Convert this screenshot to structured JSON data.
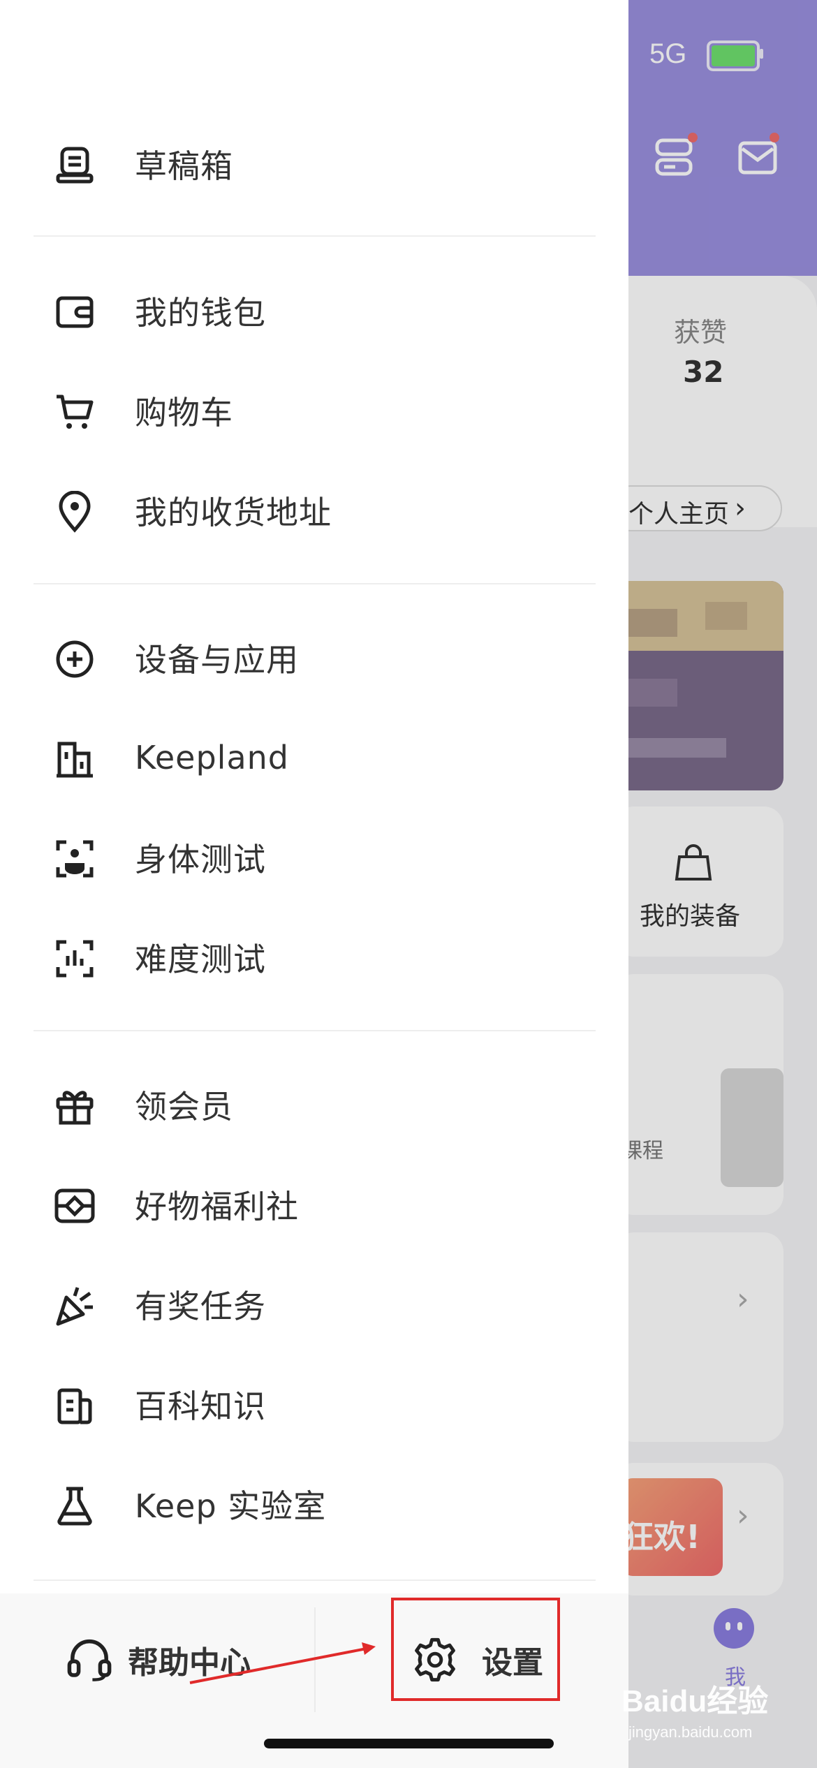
{
  "status_bar": {
    "network": "5G"
  },
  "background": {
    "likes_label": "获赞",
    "likes_count": "32",
    "profile_link": "个人主页",
    "equipment_label": "我的装备",
    "course_text": "课程",
    "banner_text": "狂欢!",
    "tab_me_label": "我",
    "colors": {
      "header": "#9a90df",
      "accent": "#8a7ee0"
    }
  },
  "drawer": {
    "groups": [
      {
        "items": [
          {
            "label": "草稿箱",
            "icon": "drafts-icon"
          }
        ]
      },
      {
        "items": [
          {
            "label": "我的钱包",
            "icon": "wallet-icon"
          },
          {
            "label": "购物车",
            "icon": "cart-icon"
          },
          {
            "label": "我的收货地址",
            "icon": "location-pin-icon"
          }
        ]
      },
      {
        "items": [
          {
            "label": "设备与应用",
            "icon": "plus-circle-icon"
          },
          {
            "label": "Keepland",
            "icon": "building-icon"
          },
          {
            "label": "身体测试",
            "icon": "body-scan-icon"
          },
          {
            "label": "难度测试",
            "icon": "difficulty-scan-icon"
          }
        ]
      },
      {
        "items": [
          {
            "label": "领会员",
            "icon": "gift-icon"
          },
          {
            "label": "好物福利社",
            "icon": "goods-icon"
          },
          {
            "label": "有奖任务",
            "icon": "party-popper-icon"
          },
          {
            "label": "百科知识",
            "icon": "encyclopedia-icon"
          },
          {
            "label": "Keep 实验室",
            "icon": "flask-icon"
          }
        ]
      }
    ],
    "footer": {
      "help_label": "帮助中心",
      "settings_label": "设置"
    }
  },
  "watermark": {
    "brand": "Baidu经验",
    "url": "jingyan.baidu.com"
  }
}
